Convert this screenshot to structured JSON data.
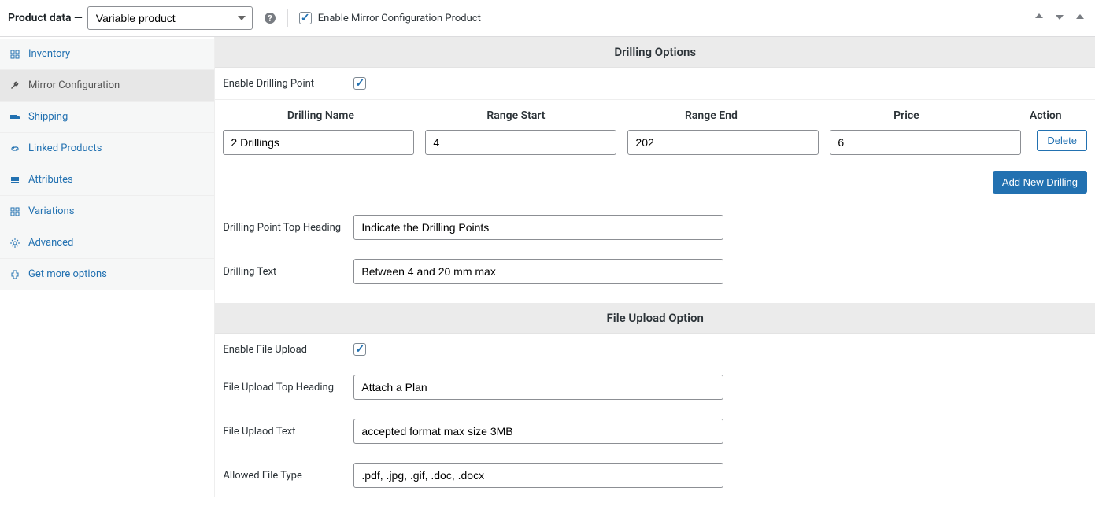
{
  "header": {
    "title": "Product data —",
    "selectValue": "Variable product",
    "enableMirrorLabel": "Enable Mirror Configuration Product"
  },
  "sidebar": {
    "tabs": [
      {
        "label": "Inventory"
      },
      {
        "label": "Mirror Configuration"
      },
      {
        "label": "Shipping"
      },
      {
        "label": "Linked Products"
      },
      {
        "label": "Attributes"
      },
      {
        "label": "Variations"
      },
      {
        "label": "Advanced"
      },
      {
        "label": "Get more options"
      }
    ]
  },
  "drilling": {
    "sectionTitle": "Drilling Options",
    "enableLabel": "Enable Drilling Point",
    "table": {
      "headers": {
        "name": "Drilling Name",
        "start": "Range Start",
        "end": "Range End",
        "price": "Price",
        "action": "Action"
      },
      "row": {
        "name": "2 Drillings",
        "start": "4",
        "end": "202",
        "price": "6"
      },
      "deleteLabel": "Delete",
      "addLabel": "Add New Drilling"
    },
    "topHeadingLabel": "Drilling Point Top Heading",
    "topHeadingValue": "Indicate the Drilling Points",
    "textLabel": "Drilling Text",
    "textValue": "Between 4 and 20 mm max"
  },
  "fileUpload": {
    "sectionTitle": "File Upload Option",
    "enableLabel": "Enable File Upload",
    "topHeadingLabel": "File Upload Top Heading",
    "topHeadingValue": "Attach a Plan",
    "textLabel": "File Uplaod Text",
    "textValue": "accepted format max size 3MB",
    "allowedLabel": "Allowed File Type",
    "allowedValue": ".pdf, .jpg, .gif, .doc, .docx"
  }
}
